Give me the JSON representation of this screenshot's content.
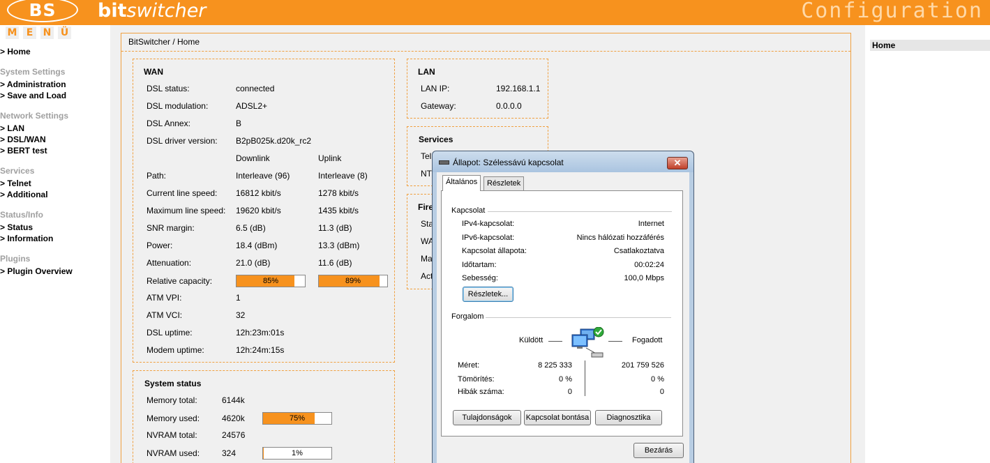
{
  "header": {
    "logo": "BS",
    "brand_bold": "bit",
    "brand_italic": "switcher",
    "config": "Configuration"
  },
  "menu": {
    "title_letters": [
      "M",
      "E",
      "N",
      "Ü"
    ],
    "home": "> Home",
    "sections": [
      {
        "title": "System Settings",
        "items": [
          "> Administration",
          "> Save and Load"
        ]
      },
      {
        "title": "Network Settings",
        "items": [
          "> LAN",
          "> DSL/WAN",
          "> BERT test"
        ]
      },
      {
        "title": "Services",
        "items": [
          "> Telnet",
          "> Additional"
        ]
      },
      {
        "title": "Status/Info",
        "items": [
          "> Status",
          "> Information"
        ]
      },
      {
        "title": "Plugins",
        "items": [
          "> Plugin Overview"
        ]
      }
    ]
  },
  "breadcrumb": "BitSwitcher / Home",
  "wan": {
    "title": "WAN",
    "dsl_status_label": "DSL status:",
    "dsl_status": "connected",
    "dsl_mod_label": "DSL modulation:",
    "dsl_mod": "ADSL2+",
    "dsl_annex_label": "DSL Annex:",
    "dsl_annex": "B",
    "driver_label": "DSL driver version:",
    "driver": "B2pB025k.d20k_rc2",
    "downlink": "Downlink",
    "uplink": "Uplink",
    "path_label": "Path:",
    "path_down": "Interleave (96)",
    "path_up": "Interleave (8)",
    "cur_speed_label": "Current line speed:",
    "cur_speed_down": "16812 kbit/s",
    "cur_speed_up": "1278 kbit/s",
    "max_speed_label": "Maximum line speed:",
    "max_speed_down": "19620 kbit/s",
    "max_speed_up": "1435 kbit/s",
    "snr_label": "SNR margin:",
    "snr_down": "6.5 (dB)",
    "snr_up": "11.3 (dB)",
    "power_label": "Power:",
    "power_down": "18.4 (dBm)",
    "power_up": "13.3 (dBm)",
    "atten_label": "Attenuation:",
    "atten_down": "21.0 (dB)",
    "atten_up": "11.6 (dB)",
    "relcap_label": "Relative capacity:",
    "relcap_down": "85%",
    "relcap_up": "89%",
    "relcap_down_value": 85,
    "relcap_up_value": 89,
    "vpi_label": "ATM VPI:",
    "vpi": "1",
    "vci_label": "ATM VCI:",
    "vci": "32",
    "dsl_uptime_label": "DSL uptime:",
    "dsl_uptime": "12h:23m:01s",
    "modem_uptime_label": "Modem uptime:",
    "modem_uptime": "12h:24m:15s"
  },
  "lan": {
    "title": "LAN",
    "ip_label": "LAN IP:",
    "ip": "192.168.1.1",
    "gw_label": "Gateway:",
    "gw": "0.0.0.0"
  },
  "services": {
    "title": "Services",
    "row1": "Tel",
    "row2": "NT"
  },
  "firewall": {
    "title": "Fire",
    "rows": [
      "Sta",
      "WA",
      "Ma",
      "Act"
    ]
  },
  "system": {
    "title": "System status",
    "mem_total_label": "Memory total:",
    "mem_total": "6144k",
    "mem_used_label": "Memory used:",
    "mem_used": "4620k",
    "mem_used_pct": "75%",
    "mem_used_value": 75,
    "nvram_total_label": "NVRAM total:",
    "nvram_total": "24576",
    "nvram_used_label": "NVRAM used:",
    "nvram_used": "324",
    "nvram_used_pct": "1%",
    "nvram_used_value": 1
  },
  "right": {
    "home": "Home"
  },
  "dialog": {
    "title": "Állapot: Szélessávú kapcsolat",
    "close": "✕",
    "tab_general": "Általános",
    "tab_details": "Részletek",
    "conn_group": "Kapcsolat",
    "ipv4_label": "IPv4-kapcsolat:",
    "ipv4": "Internet",
    "ipv6_label": "IPv6-kapcsolat:",
    "ipv6": "Nincs hálózati hozzáférés",
    "state_label": "Kapcsolat állapota:",
    "state": "Csatlakoztatva",
    "duration_label": "Időtartam:",
    "duration": "00:02:24",
    "speed_label": "Sebesség:",
    "speed": "100,0 Mbps",
    "details_button": "Részletek...",
    "traffic_group": "Forgalom",
    "sent": "Küldött",
    "received": "Fogadott",
    "size_label": "Méret:",
    "size_sent": "8 225 333",
    "size_recv": "201 759 526",
    "compress_label": "Tömörítés:",
    "compress_sent": "0 %",
    "compress_recv": "0 %",
    "errors_label": "Hibák száma:",
    "errors_sent": "0",
    "errors_recv": "0",
    "props_button": "Tulajdonságok",
    "disconnect_button": "Kapcsolat bontása",
    "diag_button": "Diagnosztika",
    "close_button": "Bezárás"
  }
}
